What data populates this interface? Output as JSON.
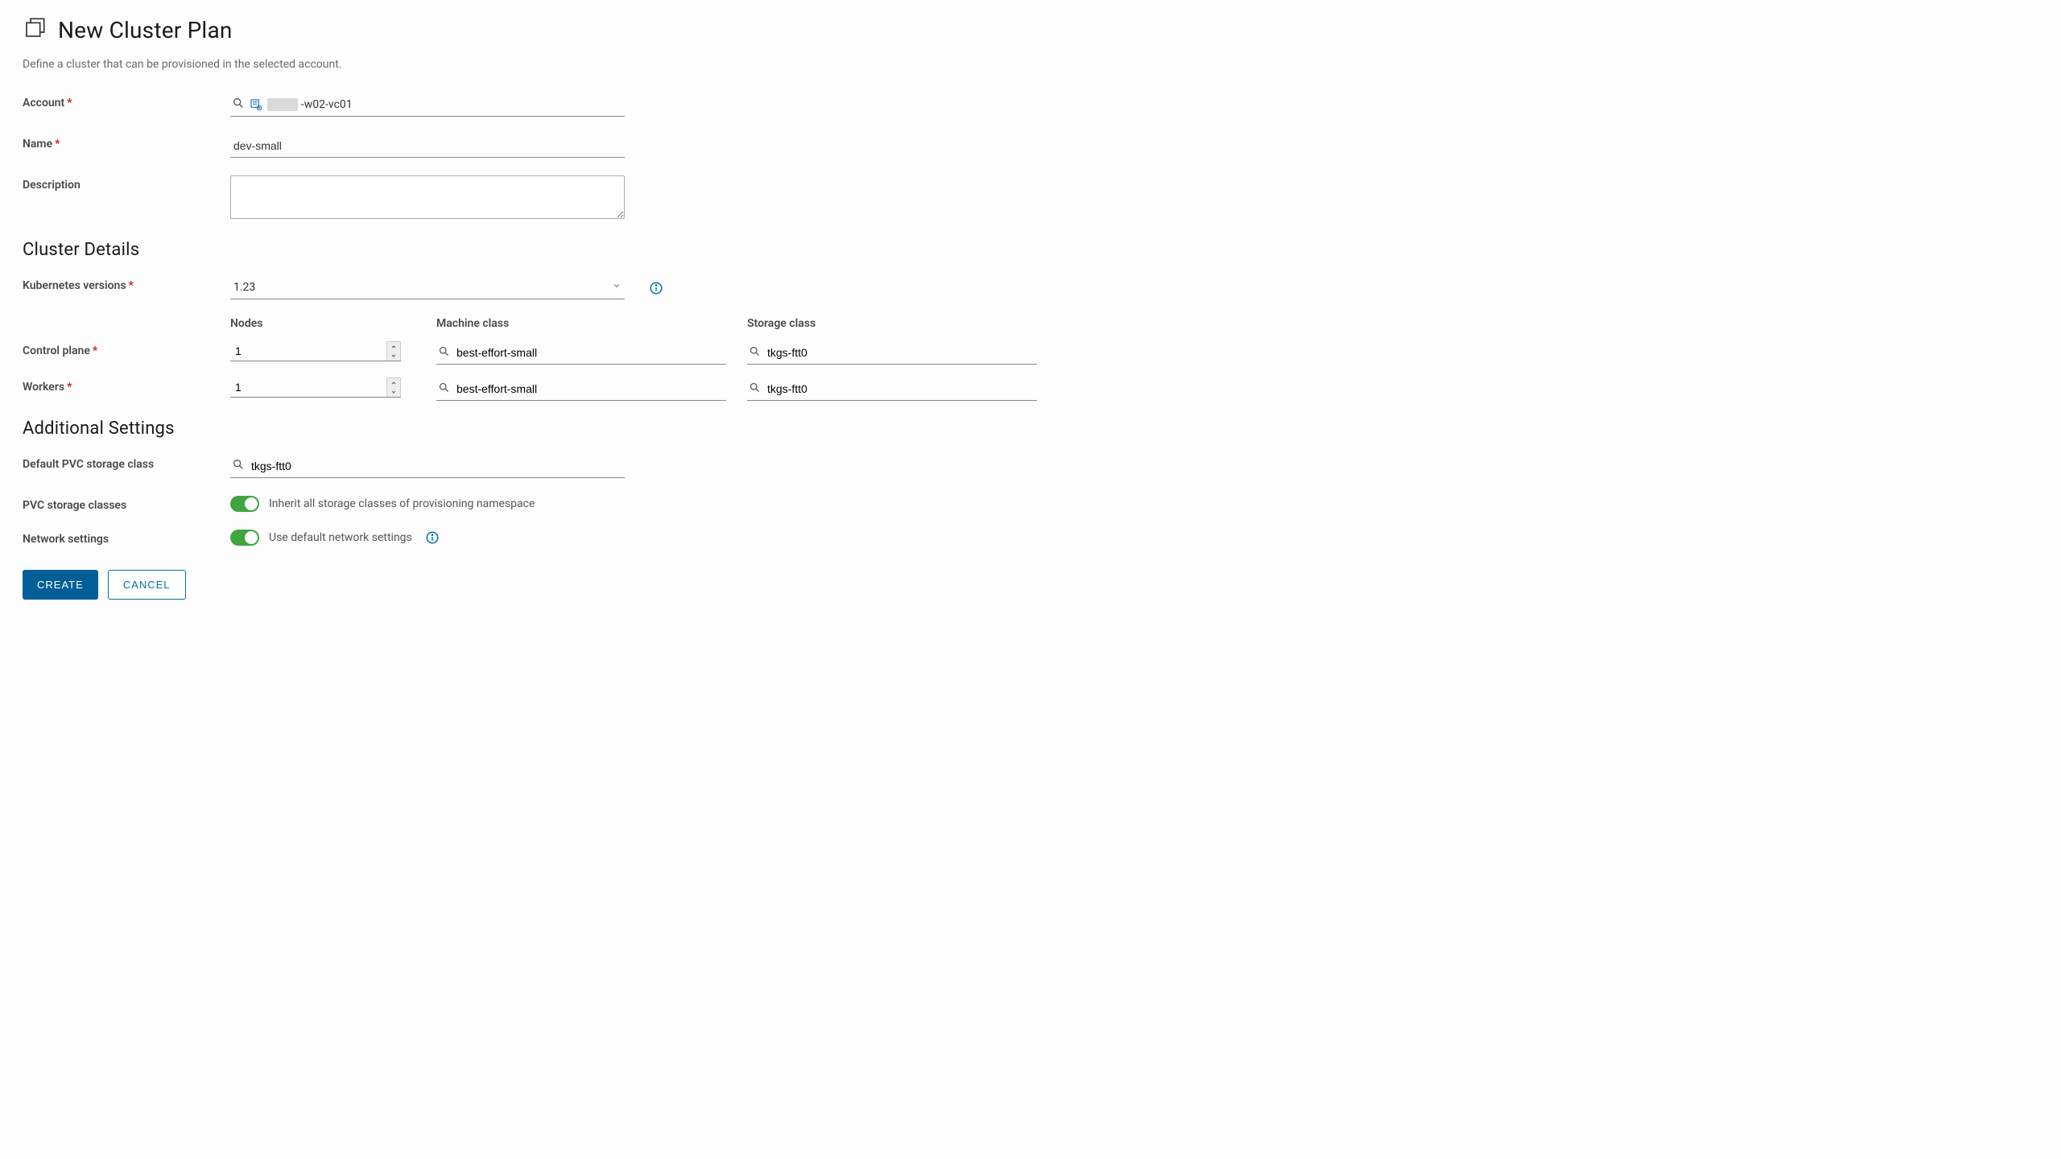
{
  "header": {
    "title": "New Cluster Plan",
    "subtitle": "Define a cluster that can be provisioned in the selected account."
  },
  "labels": {
    "account": "Account",
    "name": "Name",
    "description": "Description",
    "cluster_details": "Cluster Details",
    "k8s_versions": "Kubernetes versions",
    "nodes": "Nodes",
    "machine_class": "Machine class",
    "storage_class": "Storage class",
    "control_plane": "Control plane",
    "workers": "Workers",
    "additional_settings": "Additional Settings",
    "default_pvc": "Default PVC storage class",
    "pvc_classes": "PVC storage classes",
    "network_settings": "Network settings"
  },
  "values": {
    "account_suffix": "-w02-vc01",
    "name": "dev-small",
    "description": "",
    "k8s_version": "1.23",
    "control_plane_nodes": "1",
    "control_plane_machine": "best-effort-small",
    "control_plane_storage": "tkgs-ftt0",
    "workers_nodes": "1",
    "workers_machine": "best-effort-small",
    "workers_storage": "tkgs-ftt0",
    "default_pvc_storage": "tkgs-ftt0"
  },
  "toggles": {
    "pvc_inherit_label": "Inherit all storage classes of provisioning namespace",
    "network_default_label": "Use default network settings"
  },
  "buttons": {
    "create": "CREATE",
    "cancel": "CANCEL"
  }
}
